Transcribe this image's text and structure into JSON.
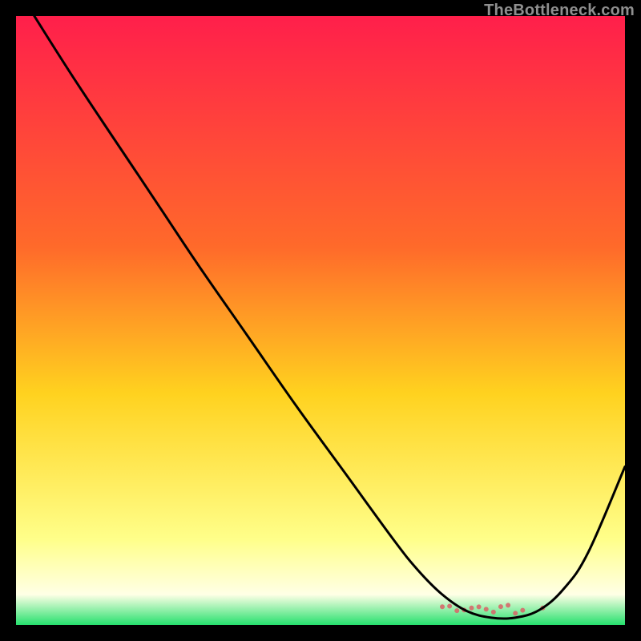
{
  "watermark": "TheBottleneck.com",
  "colors": {
    "bg": "#000000",
    "grad_top": "#ff1f4b",
    "grad_mid1": "#ff6a2a",
    "grad_mid2": "#ffd21f",
    "grad_bottom1": "#ffff8a",
    "grad_bottom2": "#ffffe6",
    "grad_green": "#25e06d",
    "curve": "#000000",
    "marker": "#d56a6a"
  },
  "chart_data": {
    "type": "line",
    "title": "",
    "xlabel": "",
    "ylabel": "",
    "xlim": [
      0,
      100
    ],
    "ylim": [
      0,
      100
    ],
    "grid": false,
    "series": [
      {
        "name": "bottleneck-curve",
        "x": [
          3,
          10,
          20,
          24,
          30,
          38,
          46,
          54,
          62,
          66,
          70,
          74,
          78,
          82,
          86,
          90,
          94,
          100
        ],
        "y": [
          100,
          89,
          74,
          68,
          59,
          47.5,
          36,
          25,
          14,
          9,
          5,
          2.3,
          1.2,
          1.2,
          2.5,
          6,
          12,
          26
        ]
      }
    ],
    "annotations": [
      {
        "type": "marker-band",
        "x_start": 70,
        "x_end": 84,
        "y": 2.5
      }
    ]
  }
}
